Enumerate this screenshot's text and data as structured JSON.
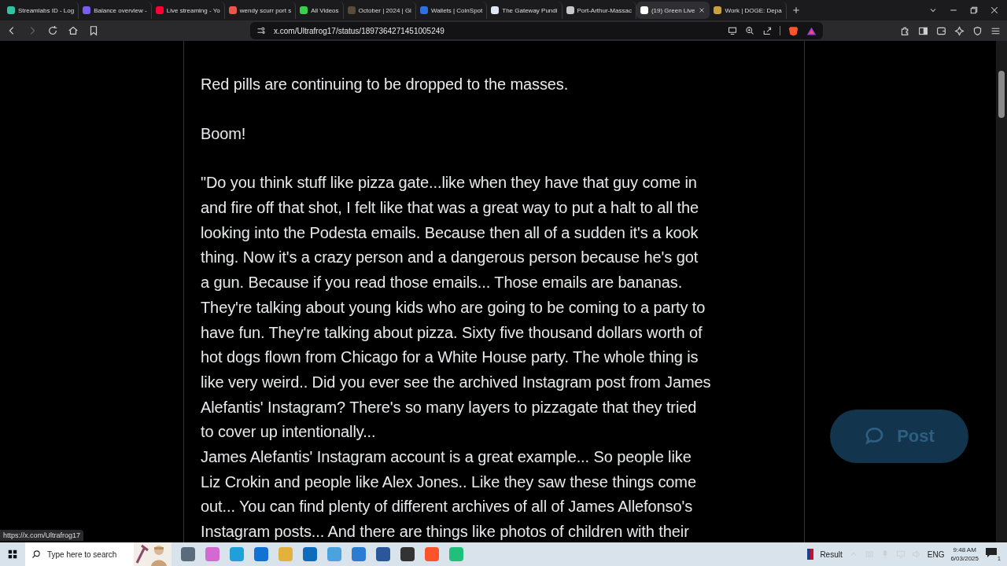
{
  "tabs": [
    {
      "title": "Streamlabs ID - Log",
      "color": "#31c3a2",
      "selected": false
    },
    {
      "title": "Balance overview -",
      "color": "#7b5cf0",
      "selected": false
    },
    {
      "title": "Live streaming - Yo",
      "color": "#ff0033",
      "selected": false
    },
    {
      "title": "wendy scurr port s",
      "color": "#e8574a",
      "selected": false
    },
    {
      "title": "All Videos",
      "color": "#3ccf4e",
      "selected": false
    },
    {
      "title": "October | 2024 | Gl",
      "color": "#5a4a3a",
      "selected": false
    },
    {
      "title": "Wallets | CoinSpot",
      "color": "#2f6fe0",
      "selected": false
    },
    {
      "title": "The Gateway Pundi",
      "color": "#dfe6f5",
      "selected": false
    },
    {
      "title": "Port-Arthur-Massac",
      "color": "#c9c9c9",
      "selected": false
    },
    {
      "title": "(19) Green Live",
      "color": "#ffffff",
      "selected": true
    },
    {
      "title": "Work | DOGE: Depa",
      "color": "#c9a040",
      "selected": false
    }
  ],
  "address": "x.com/Ultrafrog17/status/1897364271451005249",
  "post": {
    "paragraphs": [
      [
        "Red pills are continuing to be dropped to the masses."
      ],
      [
        "Boom!"
      ],
      [
        "\"Do you think stuff like pizza gate...like when they have that guy come in",
        "and fire off that shot, I felt like that was a great way to put a halt to all the",
        "looking into the Podesta emails. Because then all of a sudden it's a kook",
        "thing. Now it's a crazy person and a dangerous person because he's got",
        "a gun. Because if you read those emails... Those emails are bananas.",
        "They're talking about young kids who are going to be coming to a party to",
        "have fun. They're talking about pizza. Sixty five thousand dollars worth of",
        "hot dogs flown from Chicago for a White House party. The whole thing is",
        "like very weird.. Did you ever see the archived Instagram post from James",
        "Alefantis' Instagram? There's so many layers to pizzagate that they tried",
        "to cover up intentionally...",
        "James Alefantis' Instagram account is a great example... So people like",
        "Liz Crokin and people like Alex Jones.. Like they saw these things come",
        "out... You can find plenty of different archives of all of James Allefonso's",
        "Instagram posts... And there are things like photos of children with their"
      ]
    ]
  },
  "post_button": "Post",
  "status_url": "https://x.com/Ultrafrog17",
  "taskbar": {
    "search_placeholder": "Type here to search",
    "weather": "Result",
    "language": "ENG",
    "time": "9:48 AM",
    "date": "6/03/2025",
    "notifications": "1"
  }
}
